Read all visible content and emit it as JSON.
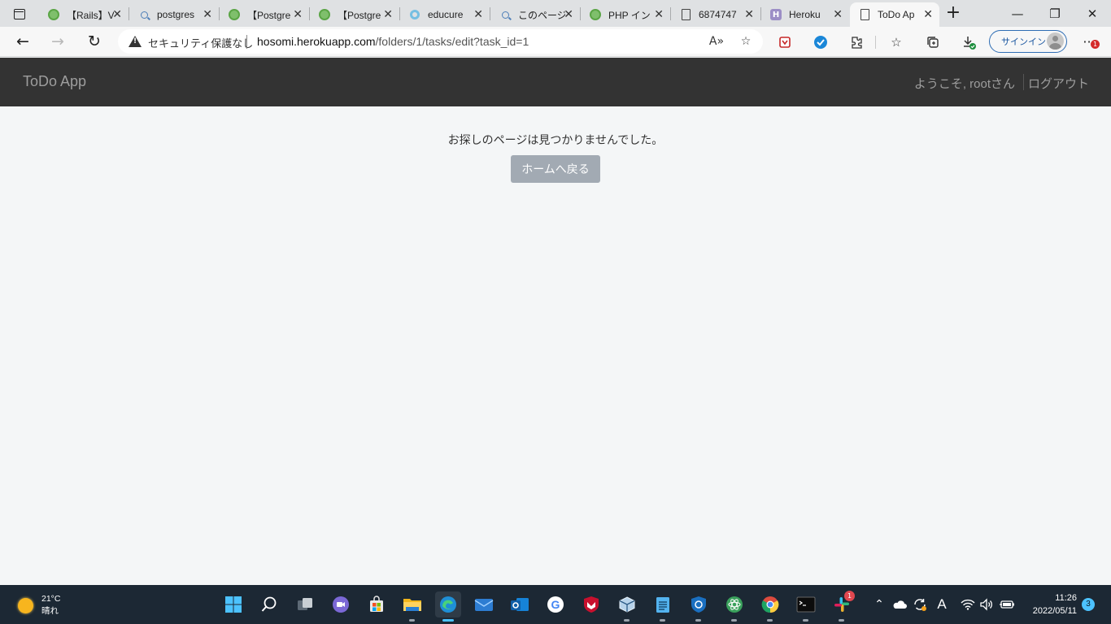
{
  "browser": {
    "tabs": [
      {
        "title": "【Rails】V",
        "icon": "green-circle"
      },
      {
        "title": "postgres",
        "icon": "search"
      },
      {
        "title": "【Postgre",
        "icon": "green-circle"
      },
      {
        "title": "【Postgre",
        "icon": "green-circle"
      },
      {
        "title": "educure",
        "icon": "blue-ring"
      },
      {
        "title": "このページ",
        "icon": "search"
      },
      {
        "title": "PHP イン",
        "icon": "green-circle"
      },
      {
        "title": "6874747",
        "icon": "document"
      },
      {
        "title": "Heroku",
        "icon": "heroku"
      },
      {
        "title": "ToDo Ap",
        "icon": "document"
      }
    ],
    "active_tab_index": 9,
    "security_label": "セキュリティ保護なし",
    "url_host": "hosomi.herokuapp.com",
    "url_path": "/folders/1/tasks/edit?task_id=1",
    "signin_label": "サインイン",
    "more_badge": "1"
  },
  "app": {
    "brand": "ToDo App",
    "welcome": "ようこそ, rootさん",
    "logout": "ログアウト",
    "message": "お探しのページは見つかりませんでした。",
    "home_button": "ホームへ戻る"
  },
  "taskbar": {
    "weather_temp": "21°C",
    "weather_desc": "晴れ",
    "slack_badge": "1",
    "time": "11:26",
    "date": "2022/05/11",
    "notification_count": "3"
  },
  "colors": {
    "navbar": "#333333",
    "page_background": "#f4f6f7",
    "button": "#a2aab3",
    "taskbar": "#1c2834",
    "accent": "#2e6db4"
  }
}
